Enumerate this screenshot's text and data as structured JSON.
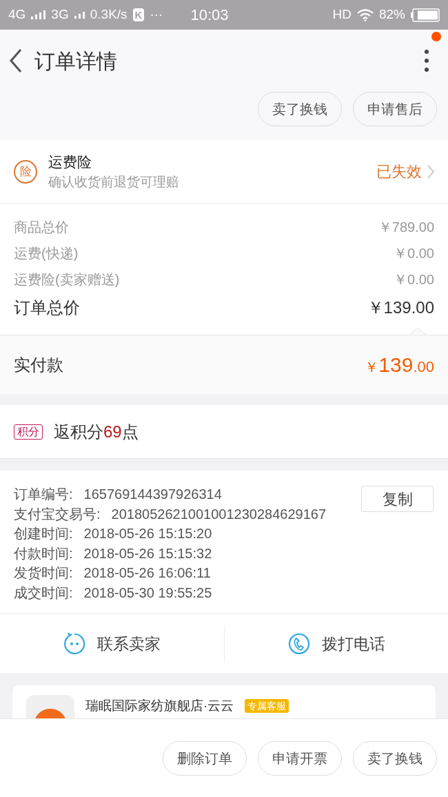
{
  "status_bar": {
    "network_1": "4G",
    "network_2": "3G",
    "speed": "0.3K/s",
    "app_badge": "K",
    "more": "···",
    "time": "10:03",
    "hd": "HD",
    "battery": "82%"
  },
  "header": {
    "title": "订单详情",
    "has_notification": true,
    "action_buttons": [
      "卖了换钱",
      "申请售后"
    ]
  },
  "insurance": {
    "badge": "险",
    "title": "运费险",
    "subtitle": "确认收货前退货可理赔",
    "status": "已失效"
  },
  "prices": [
    {
      "label": "商品总价",
      "value": "￥789.00"
    },
    {
      "label": "运费(快递)",
      "value": "￥0.00"
    },
    {
      "label": "运费险(卖家赠送)",
      "value": "￥0.00"
    }
  ],
  "total": {
    "label": "订单总价",
    "value": "￥139.00"
  },
  "paid": {
    "label": "实付款",
    "currency": "￥",
    "integer": "139",
    "decimals": ".00"
  },
  "points": {
    "badge": "积分",
    "prefix": "返积分",
    "amount": "69",
    "suffix": "点"
  },
  "order_info": {
    "copy_button": "复制",
    "rows": [
      {
        "label": "订单编号:",
        "value": "165769144397926314"
      },
      {
        "label": "支付宝交易号:",
        "value": "2018052621001001230284629167"
      },
      {
        "label": "创建时间:",
        "value": "2018-05-26 15:15:20"
      },
      {
        "label": "付款时间:",
        "value": "2018-05-26 15:15:32"
      },
      {
        "label": "发货时间:",
        "value": "2018-05-26 16:06:11"
      },
      {
        "label": "成交时间:",
        "value": "2018-05-30 19:55:25"
      }
    ]
  },
  "contact": [
    {
      "kind": "chat",
      "label": "联系卖家"
    },
    {
      "kind": "phone",
      "label": "拨打电话"
    }
  ],
  "store": {
    "name": "瑞眠国际家纺旗舰店·云云",
    "badge": "专属客服"
  },
  "bottom_buttons": [
    "删除订单",
    "申请开票",
    "卖了换钱"
  ]
}
